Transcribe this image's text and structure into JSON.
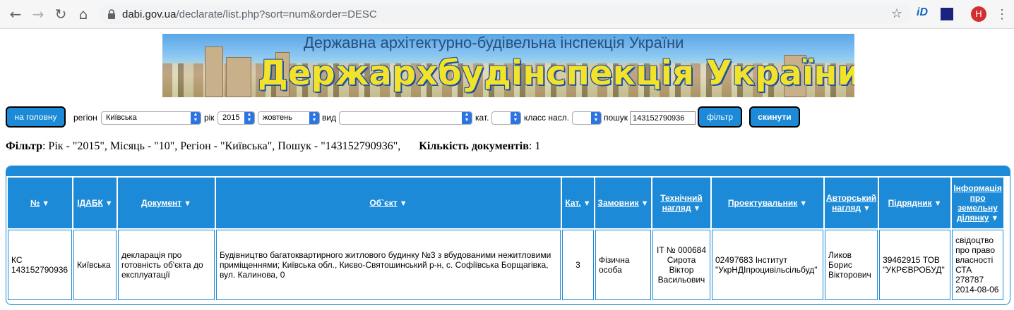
{
  "browser": {
    "url_host": "dabi.gov.ua",
    "url_path": "/declarate/list.php?sort=num&order=DESC",
    "avatar_letter": "H",
    "ext_label": "iD"
  },
  "banner": {
    "subtitle": "Державна архітектурно-будівельна інспекція України",
    "title": "Держархбудінспекція України"
  },
  "filters": {
    "home_button": "на головну",
    "region_label": "регіон",
    "region_value": "Київська",
    "year_label": "рік",
    "year_value": "2015",
    "month_value": "жовтень",
    "kind_label": "вид",
    "kind_value": "",
    "cat_label": "кат.",
    "cat_value": "",
    "class_label": "класс насл.",
    "class_value": "",
    "search_label": "пошук",
    "search_value": "143152790936",
    "filter_button": "фільтр",
    "reset_button": "скинути"
  },
  "filter_summary": {
    "label": "Фільтр",
    "text": ": Рік - \"2015\", Місяць - \"10\", Регіон - \"Київська\", Пошук - \"143152790936\",",
    "count_label": "Кількість документів",
    "count_value": ": 1"
  },
  "table": {
    "headers": [
      "№",
      "ІДАБК",
      "Документ",
      "Об`єкт",
      "Кат.",
      "Замовник",
      "Технічний нагляд",
      "Проектувальник",
      "Авторський нагляд",
      "Підрядник",
      "Інформація про земельну ділянку"
    ],
    "rows": [
      {
        "num": "КС 143152790936",
        "idabk": "Київська",
        "document": "декларація про готовність об'єкта до експлуатації",
        "object": "Будівництво багатоквартирного житлового будинку №3 з вбудованими нежитловими приміщеннями; Київська обл., Києво-Святошинський р-н, с. Софіївська Борщагівка, вул. Калинова, 0",
        "cat": "3",
        "customer": "Фізична особа",
        "tech_supervision": "IT № 000684 Сирота Віктор Васильович",
        "designer": "02497683 Інститут \"УкрНДІпроцивільсільбуд\"",
        "author_supervision": "Ликов Борис Вікторович",
        "contractor": "39462915 ТОВ \"УКРЄВРОБУД\"",
        "land_info": "свідоцтво про право власності СТА 278787 2014-08-06"
      }
    ]
  }
}
